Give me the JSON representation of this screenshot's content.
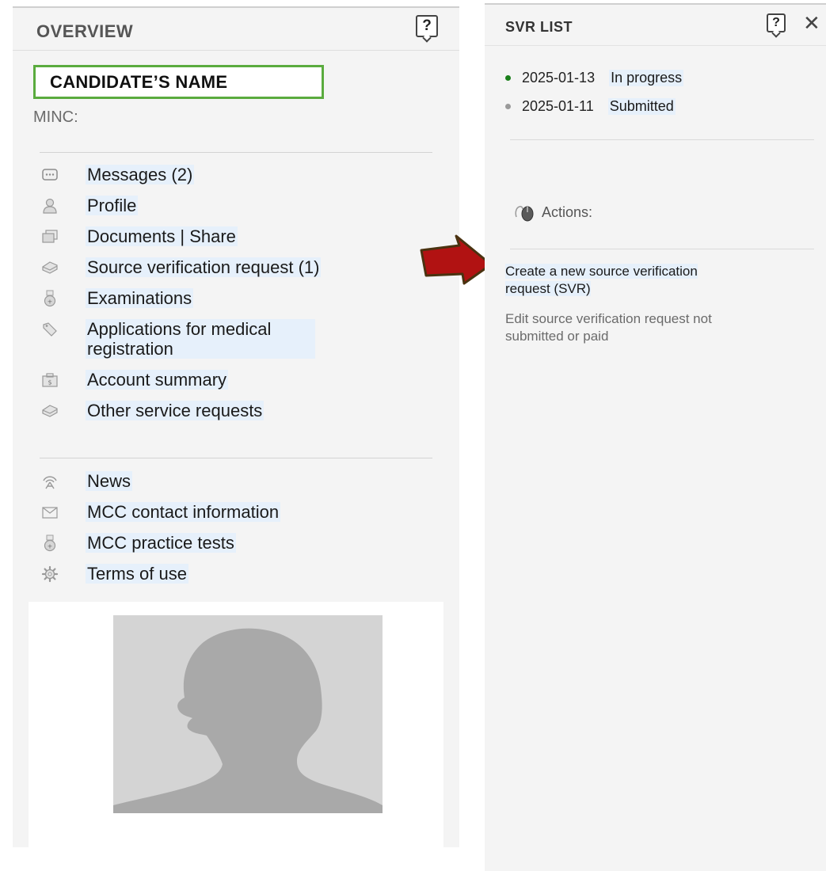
{
  "overview": {
    "title": "OVERVIEW",
    "help_label": "?",
    "candidate_name": "CANDIDATE’S NAME",
    "minc_label": "MINC:",
    "menu_primary": [
      {
        "label": "Messages (2)",
        "icon": "messages-icon"
      },
      {
        "label": "Profile",
        "icon": "profile-icon"
      },
      {
        "label": "Documents | Share",
        "icon": "documents-icon"
      },
      {
        "label": "Source verification request (1)",
        "icon": "source-verification-icon"
      },
      {
        "label": "Examinations",
        "icon": "examinations-icon"
      },
      {
        "label": "Applications for medical registration",
        "icon": "applications-icon"
      },
      {
        "label": "Account summary",
        "icon": "account-summary-icon"
      },
      {
        "label": "Other service requests",
        "icon": "service-requests-icon"
      }
    ],
    "menu_secondary": [
      {
        "label": "News",
        "icon": "news-icon"
      },
      {
        "label": "MCC contact information",
        "icon": "envelope-icon"
      },
      {
        "label": "MCC practice tests",
        "icon": "practice-tests-icon"
      },
      {
        "label": "Terms of use",
        "icon": "gear-icon"
      }
    ]
  },
  "svr_list": {
    "title": "SVR LIST",
    "help_label": "?",
    "close_label": "✕",
    "items": [
      {
        "date": "2025-01-13",
        "status": "In progress",
        "dot_color": "#1a7f1a"
      },
      {
        "date": "2025-01-11",
        "status": "Submitted",
        "dot_color": "#9a9a9a"
      }
    ],
    "actions_label": "Actions:",
    "create_link": "Create a new source verification request (SVR)",
    "edit_text": "Edit source verification request not submitted or paid"
  },
  "colors": {
    "name_border": "#5aab3e",
    "arrow_fill": "#b11212",
    "link_highlight": "#e6f0fb"
  }
}
